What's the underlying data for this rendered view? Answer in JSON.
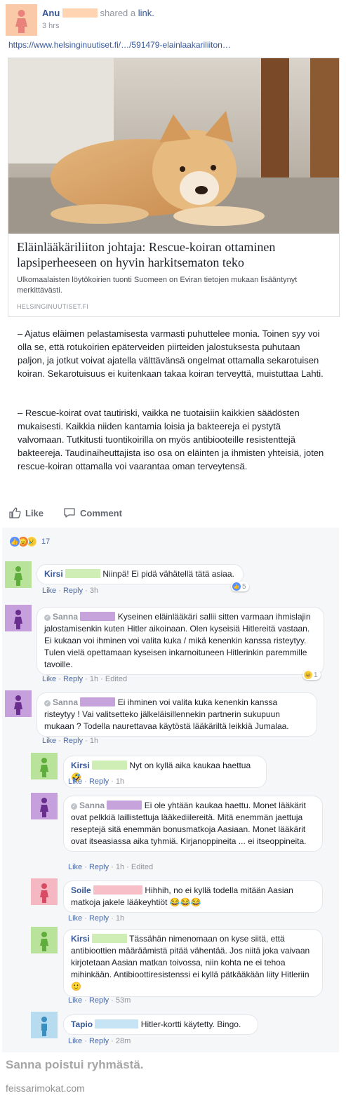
{
  "colors": {
    "link_blue": "#365899",
    "meta_gray": "#90949c",
    "redaction_orange": "#ffd4b3",
    "redaction_green": "#cfeeb5",
    "redaction_purple": "#c7a3dc",
    "redaction_pink": "#f7bfc8",
    "redaction_blue": "#c7e4f4"
  },
  "post": {
    "author": "Anu",
    "verb": "shared a",
    "link_word": "link.",
    "time": "3 hrs",
    "url": "https://www.helsinginuutiset.fi/…/591479-elainlaakariliiton…",
    "card": {
      "photo_icon": "puppy-photo",
      "title": "Eläinlääkäriliiton johtaja: Rescue-koiran ottaminen lapsiperheeseen on hyvin harkitsematon teko",
      "description": "Ulkomaalaisten löytökoirien tuonti Suomeen on Eviran tietojen mukaan lisääntynyt merkittävästi.",
      "domain": "HELSINGINUUTISET.FI"
    },
    "paragraphs": [
      "– Ajatus eläimen pelastamisesta varmasti puhuttelee monia. Toinen syy voi olla se, että rotukoirien epäterveiden piirteiden jalostuksesta puhutaan paljon, ja jotkut voivat ajatella välttävänsä ongelmat ottamalla sekarotuisen koiran. Sekarotuisuus ei kuitenkaan takaa koiran terveyttä, muistuttaa Lahti.",
      "– Rescue-koirat ovat tautiriski, vaikka ne tuotaisiin kaikkien säädösten mukaisesti. Kaikkia niiden kantamia loisia ja bakteereja ei pystytä valvomaan. Tutkitusti tuontikoirilla on myös antibiooteille resistenttejä bakteereja. Taudinaiheuttajista iso osa on eläinten ja ihmisten yhteisiä, joten rescue-koiran ottamalla voi vaarantaa oman terveytensä."
    ],
    "actions": {
      "like": "Like",
      "comment": "Comment"
    },
    "reactions": {
      "icons": [
        "like-icon",
        "angry-icon",
        "sad-icon"
      ],
      "count": "17"
    }
  },
  "comments": [
    {
      "name": "Kirsi",
      "text": "Niinpä! Ei pidä vähätellä tätä asiaa.",
      "like": "Like",
      "reply": "Reply",
      "time": "3h",
      "edited": "",
      "badge": "5",
      "badge_icon": "like-icon"
    },
    {
      "name": "Sanna",
      "text": "Kyseinen eläinlääkäri sallii sitten varmaan ihmislajin jalostamisenkin kuten Hitler aikoinaan. Olen kyseisiä Hitlereitä vastaan. Ei kukaan voi ihminen voi valita kuka / mikä kenenkin kanssa risteytyy. Tulen vielä opettamaan kyseisen inkarnoituneen Hitlerinkin paremmille tavoille.",
      "like": "Like",
      "reply": "Reply",
      "time": "1h",
      "edited": "Edited",
      "badge": "1",
      "badge_icon": "laugh-icon"
    },
    {
      "name": "Sanna",
      "text": "Ei ihminen voi valita kuka kenenkin kanssa risteytyy ! Vai valitsetteko jälkeläisillennekin partnerin sukupuun mukaan ? Todella naurettavaa käytöstä lääkäriltä leikkiä Jumalaa.",
      "like": "Like",
      "reply": "Reply",
      "time": "1h",
      "edited": "",
      "badge": "",
      "badge_icon": ""
    }
  ],
  "replies": [
    {
      "name": "Kirsi",
      "text": "Nyt on kyllä aika kaukaa haettua 🤣",
      "like": "Like",
      "reply": "Reply",
      "time": "1h",
      "edited": ""
    },
    {
      "name": "Sanna",
      "text": "Ei ole yhtään kaukaa haettu. Monet lääkärit ovat pelkkiä laillistettuja lääkediilereitä. Mitä enemmän jaettuja reseptejä sitä enemmän bonusmatkoja Aasiaan. Monet lääkärit ovat itseasiassa aika tyhmiä. Kirjanoppineita ... ei itseoppineita.",
      "like": "Like",
      "reply": "Reply",
      "time": "1h",
      "edited": "Edited"
    },
    {
      "name": "Soile",
      "text": "Hihhih, no ei kyllä todella mitään Aasian matkoja jakele lääkeyhtiöt 😂😂😂",
      "like": "Like",
      "reply": "Reply",
      "time": "1h",
      "edited": ""
    },
    {
      "name": "Kirsi",
      "text": "Tässähän nimenomaan on kyse siitä, että antibioottien määräämistä pitää vähentää. Jos niitä joka vaivaan kirjotetaan Aasian matkan toivossa, niin kohta ne ei tehoa mihinkään. Antibioottiresistenssi ei kyllä pätkääkään liity Hitleriin 🙂",
      "like": "Like",
      "reply": "Reply",
      "time": "53m",
      "edited": ""
    },
    {
      "name": "Tapio",
      "text": "Hitler-kortti käytetty. Bingo.",
      "like": "Like",
      "reply": "Reply",
      "time": "28m",
      "edited": ""
    }
  ],
  "footer": {
    "caption": "Sanna poistui ryhmästä.",
    "watermark": "feissarimokat.com"
  }
}
